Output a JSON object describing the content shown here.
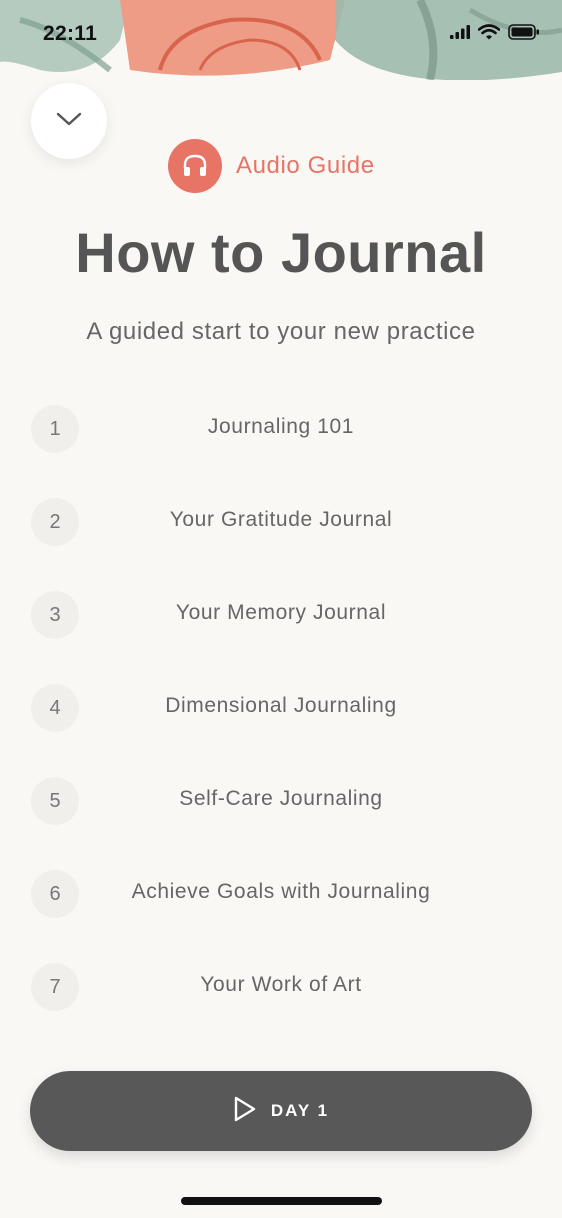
{
  "status_bar": {
    "time": "22:11"
  },
  "guide": {
    "label": "Audio Guide"
  },
  "title": "How to Journal",
  "subtitle": "A guided start to your new practice",
  "lessons": [
    {
      "number": "1",
      "title": "Journaling 101"
    },
    {
      "number": "2",
      "title": "Your Gratitude Journal"
    },
    {
      "number": "3",
      "title": "Your Memory Journal"
    },
    {
      "number": "4",
      "title": "Dimensional Journaling"
    },
    {
      "number": "5",
      "title": "Self-Care Journaling"
    },
    {
      "number": "6",
      "title": "Achieve Goals with Journaling"
    },
    {
      "number": "7",
      "title": "Your Work of Art"
    }
  ],
  "day_button": {
    "label": "DAY 1"
  },
  "colors": {
    "accent": "#e77465",
    "button": "#585858",
    "background": "#faf8f5"
  }
}
